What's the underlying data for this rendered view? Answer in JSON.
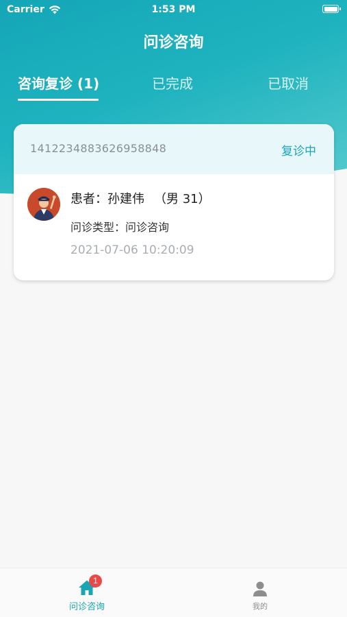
{
  "status_bar": {
    "carrier": "Carrier",
    "time": "1:53 PM"
  },
  "header": {
    "title": "问诊咨询"
  },
  "tabs": [
    {
      "label": "咨询复诊 (1)",
      "active": true
    },
    {
      "label": "已完成",
      "active": false
    },
    {
      "label": "已取消",
      "active": false
    }
  ],
  "consultations": [
    {
      "order_no": "1412234883626958848",
      "status": "复诊中",
      "patient_label": "患者：孙建伟",
      "patient_meta": "（男 31）",
      "type_line": "问诊类型：问诊咨询",
      "time": "2021-07-06 10:20:09"
    }
  ],
  "tabbar": {
    "items": [
      {
        "label": "问诊咨询",
        "icon": "home-icon",
        "badge": "1",
        "active": true
      },
      {
        "label": "我的",
        "icon": "person-icon",
        "active": false
      }
    ]
  },
  "colors": {
    "accent": "#1aa5b3",
    "badge": "#e84a4a"
  }
}
